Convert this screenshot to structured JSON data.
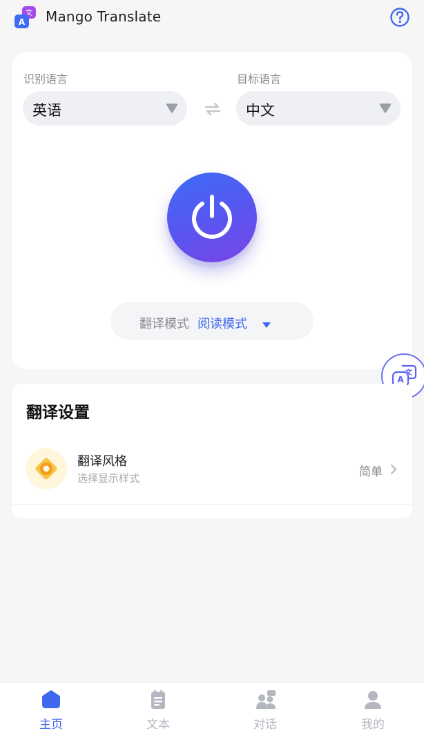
{
  "app": {
    "title": "Mango Translate",
    "logo_icon": "translate-logo-icon",
    "help_icon": "help-circle-icon"
  },
  "languages": {
    "source_label": "识别语言",
    "source_value": "英语",
    "target_label": "目标语言",
    "target_value": "中文",
    "swap_icon": "swap-arrows-icon"
  },
  "power": {
    "icon": "power-icon"
  },
  "mode": {
    "label": "翻译模式",
    "value": "阅读模式"
  },
  "settings": {
    "title": "翻译设置",
    "items": [
      {
        "name": "翻译风格",
        "desc": "选择显示样式",
        "value": "简单",
        "icon": "style-target-icon"
      }
    ]
  },
  "nav": [
    {
      "label": "主页",
      "icon": "home-icon",
      "active": true
    },
    {
      "label": "文本",
      "icon": "document-icon",
      "active": false
    },
    {
      "label": "对话",
      "icon": "conversation-icon",
      "active": false
    },
    {
      "label": "我的",
      "icon": "user-icon",
      "active": false
    }
  ],
  "colors": {
    "accent": "#3f68ee",
    "power_gradient_start": "#3d6cf5",
    "power_gradient_end": "#7a44e6"
  }
}
